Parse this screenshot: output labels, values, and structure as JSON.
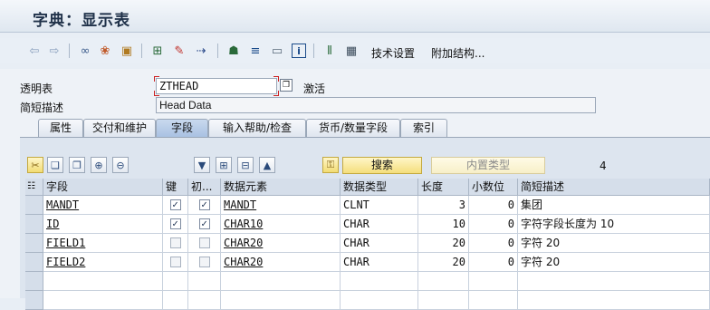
{
  "window": {
    "title": "字典：显示表"
  },
  "toolbar": {
    "icons": [
      "back-arrow-icon",
      "forward-arrow-icon",
      "glasses-icon",
      "other-object-icon",
      "activate-icon",
      "where-used-icon",
      "edit-icon",
      "export-icon",
      "hierarchy-icon",
      "stack-icon",
      "layout-icon",
      "info-icon",
      "columns-icon",
      "table-icon"
    ],
    "tech_settings": "技术设置",
    "append_structure": "附加结构..."
  },
  "form": {
    "table_label": "透明表",
    "table_value": "ZTHEAD",
    "status": "激活",
    "desc_label": "简短描述",
    "desc_value": "Head Data"
  },
  "tabs": [
    {
      "label": "属性"
    },
    {
      "label": "交付和维护"
    },
    {
      "label": "字段"
    },
    {
      "label": "输入帮助/检查"
    },
    {
      "label": "货币/数量字段"
    },
    {
      "label": "索引"
    }
  ],
  "actions": {
    "search": "搜索",
    "builtin_type": "内置类型",
    "row_count": "4"
  },
  "grid": {
    "headers": [
      "字段",
      "键",
      "初...",
      "数据元素",
      "数据类型",
      "长度",
      "小数位",
      "简短描述"
    ],
    "rows": [
      {
        "field": "MANDT",
        "key": true,
        "init": true,
        "data_element": "MANDT",
        "data_type": "CLNT",
        "length": "3",
        "decimals": "0",
        "desc": "集团"
      },
      {
        "field": "ID",
        "key": true,
        "init": true,
        "data_element": "CHAR10",
        "data_type": "CHAR",
        "length": "10",
        "decimals": "0",
        "desc": "字符字段长度为 10"
      },
      {
        "field": "FIELD1",
        "key": false,
        "init": false,
        "data_element": "CHAR20",
        "data_type": "CHAR",
        "length": "20",
        "decimals": "0",
        "desc": "字符 20"
      },
      {
        "field": "FIELD2",
        "key": false,
        "init": false,
        "data_element": "CHAR20",
        "data_type": "CHAR",
        "length": "20",
        "decimals": "0",
        "desc": "字符 20"
      }
    ],
    "check_mark": "✓"
  }
}
